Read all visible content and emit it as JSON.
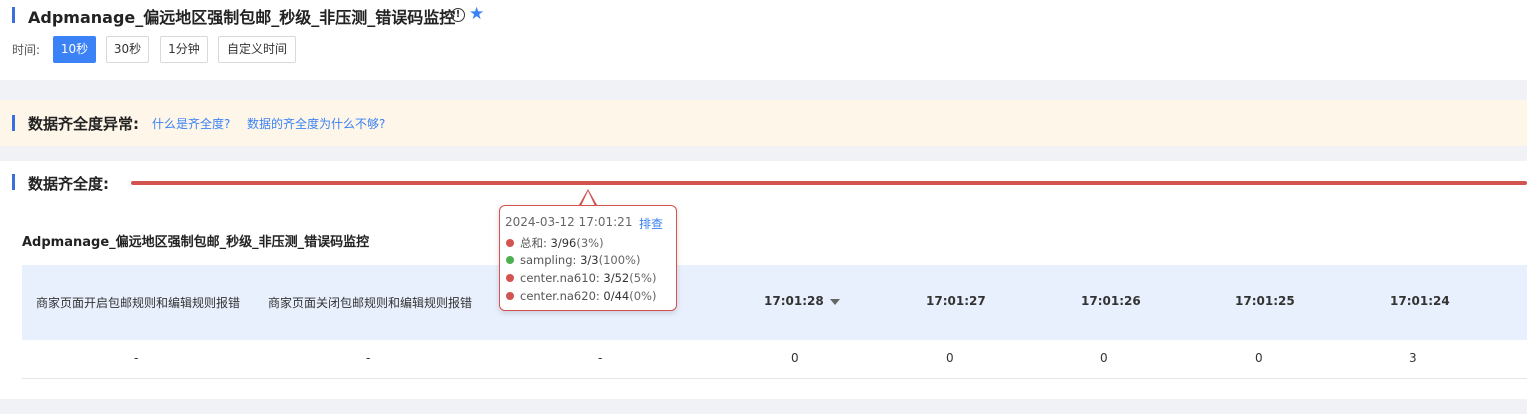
{
  "header": {
    "title": "Adpmanage_偏远地区强制包邮_秒级_非压测_错误码监控",
    "info_icon": "info-circle-icon",
    "star_icon": "star-icon",
    "time_label": "时间:",
    "time_options": [
      "10秒",
      "30秒",
      "1分钟",
      "自定义时间"
    ],
    "time_selected": "10秒"
  },
  "banner": {
    "title": "数据齐全度异常:",
    "link1": "什么是齐全度?",
    "link2": "数据的齐全度为什么不够?"
  },
  "completeness": {
    "title": "数据齐全度:",
    "line_color": "#d25350"
  },
  "tooltip": {
    "time": "2024-03-12 17:01:21",
    "action": "排查",
    "rows": [
      {
        "label": "总和:",
        "value": "3/96",
        "pct": "(3%)",
        "color": "#d25350"
      },
      {
        "label": "sampling:",
        "value": "3/3",
        "pct": "(100%)",
        "color": "#4caf50"
      },
      {
        "label": "center.na610:",
        "value": "3/52",
        "pct": "(5%)",
        "color": "#d25350"
      },
      {
        "label": "center.na620:",
        "value": "0/44",
        "pct": "(0%)",
        "color": "#d25350"
      }
    ]
  },
  "monitor": {
    "title": "Adpmanage_偏远地区强制包邮_秒级_非压测_错误码监控",
    "columns": [
      "商家页面开启包邮规则和编辑规则报错",
      "商家页面关闭包邮规则和编辑规则报错",
      "",
      "17:01:28",
      "17:01:27",
      "17:01:26",
      "17:01:25",
      "17:01:24"
    ],
    "row": [
      "-",
      "-",
      "-",
      "0",
      "0",
      "0",
      "0",
      "3"
    ]
  },
  "colors": {
    "accent": "#3b82f6",
    "error": "#d25350",
    "ok": "#4caf50"
  }
}
